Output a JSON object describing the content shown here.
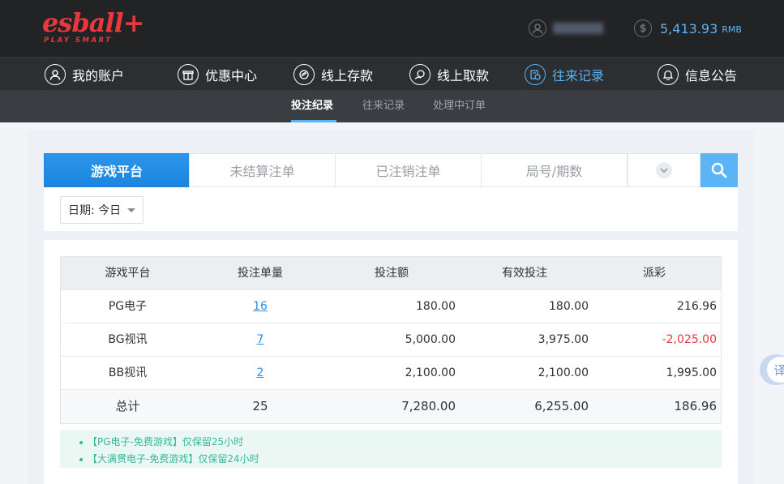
{
  "brand": {
    "logo_text": "esball+",
    "logo_sub": "PLAY SMART",
    "accent": "#5ab4f5",
    "brand_red": "#e8383d"
  },
  "header": {
    "username_masked": "",
    "balance": "5,413.93",
    "currency": "RMB",
    "user_icon": "user-icon",
    "balance_icon": "dollar-icon"
  },
  "nav": {
    "items": [
      {
        "label": "我的账户",
        "icon": "user-icon"
      },
      {
        "label": "优惠中心",
        "icon": "gift-icon"
      },
      {
        "label": "线上存款",
        "icon": "deposit-icon"
      },
      {
        "label": "线上取款",
        "icon": "withdraw-icon"
      },
      {
        "label": "往来记录",
        "icon": "records-icon",
        "active": true
      },
      {
        "label": "信息公告",
        "icon": "bell-icon"
      }
    ]
  },
  "subnav": {
    "items": [
      {
        "label": "投注纪录",
        "active": true
      },
      {
        "label": "往来记录"
      },
      {
        "label": "处理中订单"
      }
    ]
  },
  "filters": {
    "tabs": [
      {
        "label": "游戏平台",
        "active": true
      },
      {
        "label": "未结算注单"
      },
      {
        "label": "已注销注单"
      },
      {
        "label": "局号/期数"
      }
    ],
    "date_label": "日期: 今日"
  },
  "table": {
    "headers": [
      "游戏平台",
      "投注单量",
      "投注额",
      "有效投注",
      "派彩"
    ],
    "rows": [
      {
        "platform": "PG电子",
        "count": "16",
        "amount": "180.00",
        "valid": "180.00",
        "payout": "216.96"
      },
      {
        "platform": "BG视讯",
        "count": "7",
        "amount": "5,000.00",
        "valid": "3,975.00",
        "payout": "-2,025.00"
      },
      {
        "platform": "BB视讯",
        "count": "2",
        "amount": "2,100.00",
        "valid": "2,100.00",
        "payout": "1,995.00"
      }
    ],
    "total": {
      "label": "总计",
      "count": "25",
      "amount": "7,280.00",
      "valid": "6,255.00",
      "payout": "186.96"
    }
  },
  "notes": [
    "【PG电子-免费游戏】仅保留25小时",
    "【大满贯电子-免费游戏】仅保留24小时"
  ],
  "translate": {
    "label": "译"
  }
}
